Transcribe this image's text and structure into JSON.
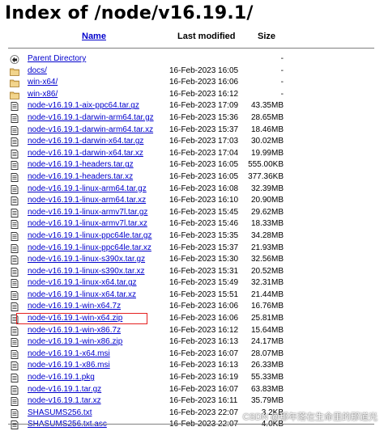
{
  "page": {
    "title": "Index of /node/v16.19.1/",
    "columns": {
      "name": "Name",
      "last_modified": "Last modified",
      "size": "Size"
    },
    "watermark": "CSDN @那年落在生命里的那道光",
    "highlight_color": "#e52020",
    "link_color": "#0000cc"
  },
  "rows": [
    {
      "icon": "back-icon",
      "name": "Parent Directory",
      "modified": "",
      "size": "-"
    },
    {
      "icon": "folder-icon",
      "name": "docs/",
      "modified": "16-Feb-2023 16:05",
      "size": "-"
    },
    {
      "icon": "folder-icon",
      "name": "win-x64/",
      "modified": "16-Feb-2023 16:06",
      "size": "-"
    },
    {
      "icon": "folder-icon",
      "name": "win-x86/",
      "modified": "16-Feb-2023 16:12",
      "size": "-"
    },
    {
      "icon": "file-icon",
      "name": "node-v16.19.1-aix-ppc64.tar.gz",
      "modified": "16-Feb-2023 17:09",
      "size": "43.35MB"
    },
    {
      "icon": "file-icon",
      "name": "node-v16.19.1-darwin-arm64.tar.gz",
      "modified": "16-Feb-2023 15:36",
      "size": "28.65MB"
    },
    {
      "icon": "file-icon",
      "name": "node-v16.19.1-darwin-arm64.tar.xz",
      "modified": "16-Feb-2023 15:37",
      "size": "18.46MB"
    },
    {
      "icon": "file-icon",
      "name": "node-v16.19.1-darwin-x64.tar.gz",
      "modified": "16-Feb-2023 17:03",
      "size": "30.02MB"
    },
    {
      "icon": "file-icon",
      "name": "node-v16.19.1-darwin-x64.tar.xz",
      "modified": "16-Feb-2023 17:04",
      "size": "19.99MB"
    },
    {
      "icon": "file-icon",
      "name": "node-v16.19.1-headers.tar.gz",
      "modified": "16-Feb-2023 16:05",
      "size": "555.00KB"
    },
    {
      "icon": "file-icon",
      "name": "node-v16.19.1-headers.tar.xz",
      "modified": "16-Feb-2023 16:05",
      "size": "377.36KB"
    },
    {
      "icon": "file-icon",
      "name": "node-v16.19.1-linux-arm64.tar.gz",
      "modified": "16-Feb-2023 16:08",
      "size": "32.39MB"
    },
    {
      "icon": "file-icon",
      "name": "node-v16.19.1-linux-arm64.tar.xz",
      "modified": "16-Feb-2023 16:10",
      "size": "20.90MB"
    },
    {
      "icon": "file-icon",
      "name": "node-v16.19.1-linux-armv7l.tar.gz",
      "modified": "16-Feb-2023 15:45",
      "size": "29.62MB"
    },
    {
      "icon": "file-icon",
      "name": "node-v16.19.1-linux-armv7l.tar.xz",
      "modified": "16-Feb-2023 15:46",
      "size": "18.33MB"
    },
    {
      "icon": "file-icon",
      "name": "node-v16.19.1-linux-ppc64le.tar.gz",
      "modified": "16-Feb-2023 15:35",
      "size": "34.28MB"
    },
    {
      "icon": "file-icon",
      "name": "node-v16.19.1-linux-ppc64le.tar.xz",
      "modified": "16-Feb-2023 15:37",
      "size": "21.93MB"
    },
    {
      "icon": "file-icon",
      "name": "node-v16.19.1-linux-s390x.tar.gz",
      "modified": "16-Feb-2023 15:30",
      "size": "32.56MB"
    },
    {
      "icon": "file-icon",
      "name": "node-v16.19.1-linux-s390x.tar.xz",
      "modified": "16-Feb-2023 15:31",
      "size": "20.52MB"
    },
    {
      "icon": "file-icon",
      "name": "node-v16.19.1-linux-x64.tar.gz",
      "modified": "16-Feb-2023 15:49",
      "size": "32.31MB"
    },
    {
      "icon": "file-icon",
      "name": "node-v16.19.1-linux-x64.tar.xz",
      "modified": "16-Feb-2023 15:51",
      "size": "21.44MB"
    },
    {
      "icon": "file-icon",
      "name": "node-v16.19.1-win-x64.7z",
      "modified": "16-Feb-2023 16:06",
      "size": "16.76MB"
    },
    {
      "icon": "file-icon",
      "name": "node-v16.19.1-win-x64.zip",
      "modified": "16-Feb-2023 16:06",
      "size": "25.81MB",
      "highlighted": true
    },
    {
      "icon": "file-icon",
      "name": "node-v16.19.1-win-x86.7z",
      "modified": "16-Feb-2023 16:12",
      "size": "15.64MB"
    },
    {
      "icon": "file-icon",
      "name": "node-v16.19.1-win-x86.zip",
      "modified": "16-Feb-2023 16:13",
      "size": "24.17MB"
    },
    {
      "icon": "file-icon",
      "name": "node-v16.19.1-x64.msi",
      "modified": "16-Feb-2023 16:07",
      "size": "28.07MB"
    },
    {
      "icon": "file-icon",
      "name": "node-v16.19.1-x86.msi",
      "modified": "16-Feb-2023 16:13",
      "size": "26.33MB"
    },
    {
      "icon": "file-icon",
      "name": "node-v16.19.1.pkg",
      "modified": "16-Feb-2023 16:19",
      "size": "55.33MB"
    },
    {
      "icon": "file-icon",
      "name": "node-v16.19.1.tar.gz",
      "modified": "16-Feb-2023 16:07",
      "size": "63.83MB"
    },
    {
      "icon": "file-icon",
      "name": "node-v16.19.1.tar.xz",
      "modified": "16-Feb-2023 16:11",
      "size": "35.79MB"
    },
    {
      "icon": "file-icon",
      "name": "SHASUMS256.txt",
      "modified": "16-Feb-2023 22:07",
      "size": "3.2KB"
    },
    {
      "icon": "file-icon",
      "name": "SHASUMS256.txt.asc",
      "modified": "16-Feb-2023 22:07",
      "size": "4.0KB"
    }
  ]
}
